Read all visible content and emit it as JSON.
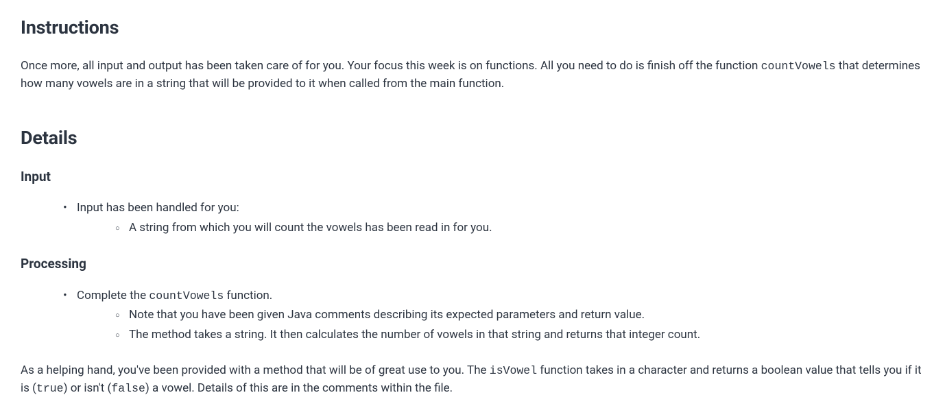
{
  "instructions": {
    "heading": "Instructions",
    "para_pre": "Once more, all input and output has been taken care of for you. Your focus this week is on functions. All you need to do is finish off the function ",
    "code": "countVowels",
    "para_post": " that determines how many vowels are in a string that will be provided to it when called from the main function."
  },
  "details": {
    "heading": "Details",
    "input": {
      "heading": "Input",
      "item": "Input has been handled for you:",
      "subitem": "A string from which you will count the vowels has been read in for you."
    },
    "processing": {
      "heading": "Processing",
      "item_pre": "Complete the ",
      "item_code": "countVowels",
      "item_post": " function.",
      "sub1": "Note that you have been given Java comments describing its expected parameters and return value.",
      "sub2": "The method takes a string. It then calculates the number of vowels in that string and returns that integer count."
    },
    "helper": {
      "pre": "As a helping hand, you've been provided with a method that will be of great use to you. The ",
      "code1": "isVowel",
      "mid1": " function takes in a character and returns a boolean value that tells you if it is (",
      "code2": "true",
      "mid2": ") or isn't (",
      "code3": "false",
      "post": ") a vowel. Details of this are in the comments within the file."
    }
  }
}
